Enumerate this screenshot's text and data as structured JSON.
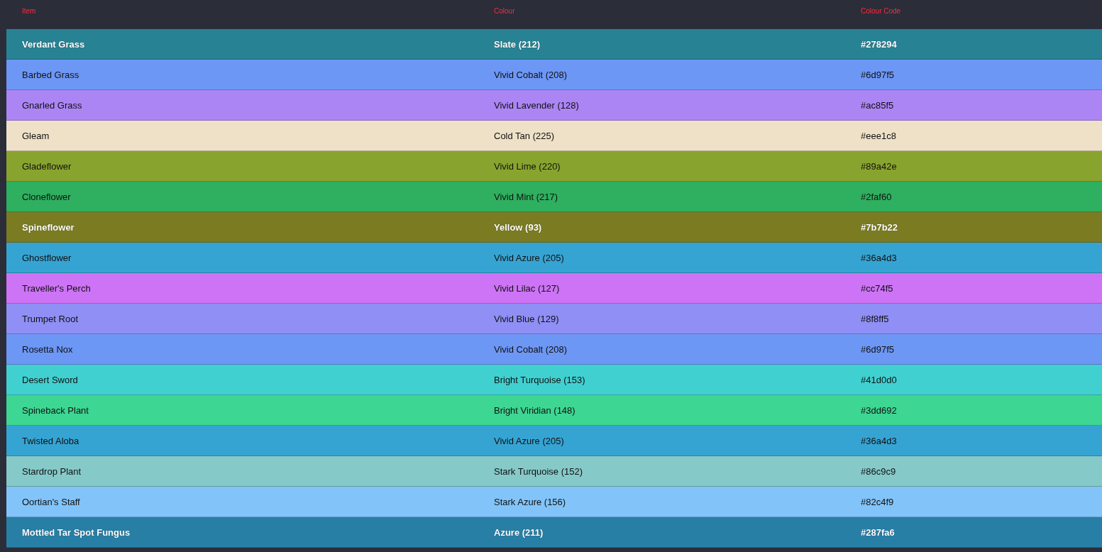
{
  "table": {
    "columns": [
      "Item",
      "Colour",
      "Colour Code"
    ],
    "rows": [
      {
        "item": "Verdant Grass",
        "colour": "Slate (212)",
        "code": "#278294",
        "color": "#278294"
      },
      {
        "item": "Barbed Grass",
        "colour": "Vivid Cobalt (208)",
        "code": "#6d97f5",
        "color": "#6d97f5"
      },
      {
        "item": "Gnarled Grass",
        "colour": "Vivid Lavender (128)",
        "code": "#ac85f5",
        "color": "#ac85f5"
      },
      {
        "item": "Gleam",
        "colour": "Cold Tan (225)",
        "code": "#eee1c8",
        "color": "#eee1c8"
      },
      {
        "item": "Gladeflower",
        "colour": "Vivid Lime (220)",
        "code": "#89a42e",
        "color": "#89a42e"
      },
      {
        "item": "Cloneflower",
        "colour": "Vivid Mint (217)",
        "code": "#2faf60",
        "color": "#2faf60"
      },
      {
        "item": "Spineflower",
        "colour": "Yellow (93)",
        "code": "#7b7b22",
        "color": "#7b7b22"
      },
      {
        "item": "Ghostflower",
        "colour": "Vivid Azure (205)",
        "code": "#36a4d3",
        "color": "#36a4d3"
      },
      {
        "item": "Traveller's Perch",
        "colour": "Vivid Lilac (127)",
        "code": "#cc74f5",
        "color": "#cc74f5"
      },
      {
        "item": "Trumpet Root",
        "colour": "Vivid Blue (129)",
        "code": "#8f8ff5",
        "color": "#8f8ff5"
      },
      {
        "item": "Rosetta Nox",
        "colour": "Vivid Cobalt (208)",
        "code": "#6d97f5",
        "color": "#6d97f5"
      },
      {
        "item": "Desert Sword",
        "colour": "Bright Turquoise (153)",
        "code": "#41d0d0",
        "color": "#41d0d0"
      },
      {
        "item": "Spineback Plant",
        "colour": "Bright Viridian (148)",
        "code": "#3dd692",
        "color": "#3dd692"
      },
      {
        "item": "Twisted Aloba",
        "colour": "Vivid Azure (205)",
        "code": "#36a4d3",
        "color": "#36a4d3"
      },
      {
        "item": "Stardrop Plant",
        "colour": "Stark Turquoise (152)",
        "code": "#86c9c9",
        "color": "#86c9c9"
      },
      {
        "item": "Oortian's Staff",
        "colour": "Stark Azure (156)",
        "code": "#82c4f9",
        "color": "#82c4f9"
      },
      {
        "item": "Mottled Tar Spot Fungus",
        "colour": "Azure (211)",
        "code": "#287fa6",
        "color": "#287fa6"
      }
    ]
  }
}
